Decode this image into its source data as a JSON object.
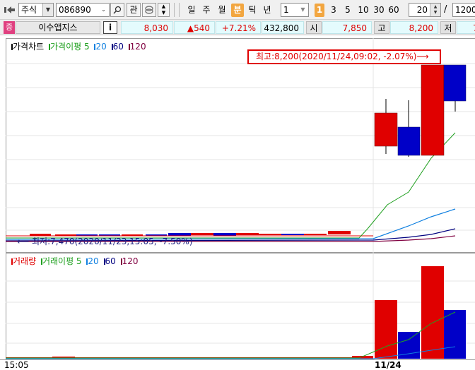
{
  "toolbar": {
    "market_type": "주식",
    "stock_code": "086890",
    "watch_label": "관",
    "periods": [
      "일",
      "주",
      "월",
      "분",
      "틱",
      "년"
    ],
    "selected_period": "분",
    "interval_value": "1",
    "quick_intervals": [
      "1",
      "3",
      "5",
      "10",
      "30",
      "60"
    ],
    "selected_quick_interval": "1",
    "count_value": "20",
    "slash": "/",
    "total_value": "1200"
  },
  "stock": {
    "badge": "증",
    "name": "이수앱지스",
    "info_label": "i",
    "price": "8,030",
    "change": "▲540",
    "change_rate": "+7.21%",
    "volume": "432,800",
    "open_label": "시",
    "open_value": "7,850",
    "high_label": "고",
    "high_value": "8,200",
    "low_label": "저",
    "low_value": "7"
  },
  "price_chart": {
    "legend": {
      "title": "가격차트",
      "ma_label": "가격이평 5",
      "ma2": "20",
      "ma3": "60",
      "ma4": "120"
    },
    "high_annotation": "최고:8,200(2020/11/24,09:02, -2.07%)⟶",
    "low_annotation": "⟵ 최저:7,470(2020/11/23,15:05, -7.50%)"
  },
  "volume_chart": {
    "legend": {
      "title": "거래량",
      "ma_label": "거래이평 5",
      "ma2": "20",
      "ma3": "60",
      "ma4": "120"
    }
  },
  "xaxis": {
    "left_label": "15:05",
    "right_label": "11/24"
  },
  "colors": {
    "up": "#e00000",
    "down": "#0000c8",
    "ma5": "#20a020",
    "ma20": "#1080e0",
    "ma60": "#000080",
    "ma120": "#800040",
    "selected_period": "#f2a640",
    "badge": "#e04080"
  }
}
